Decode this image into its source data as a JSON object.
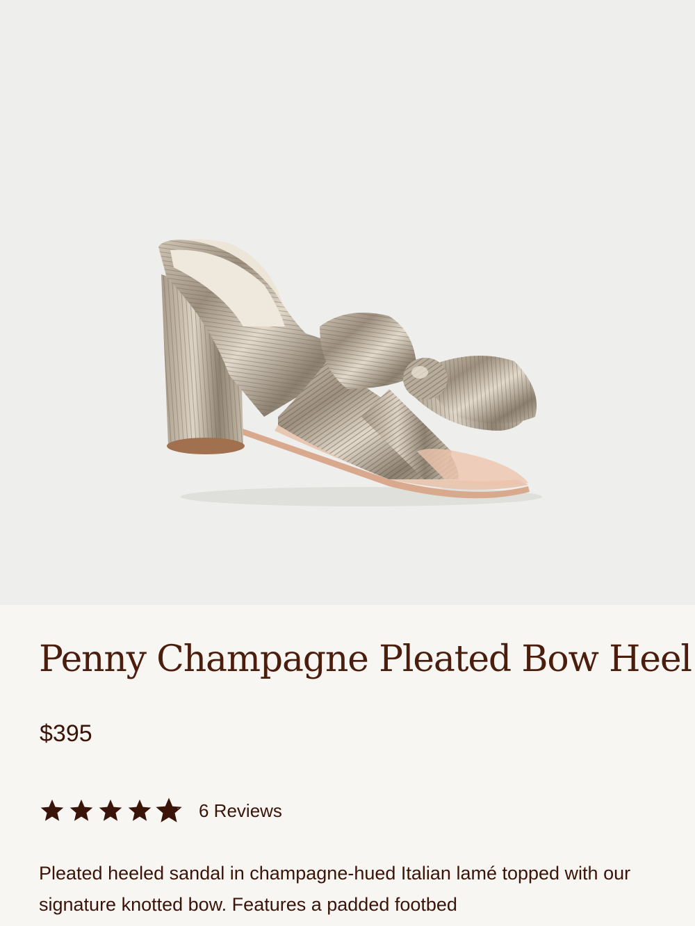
{
  "product": {
    "title": "Penny Champagne Pleated Bow Heel",
    "price": "$395",
    "rating": 4.8,
    "reviews_label": "6 Reviews",
    "description": "Pleated heeled sandal in champagne-hued Italian lamé topped with our signature knotted bow. Features a padded footbed",
    "image_alt": "Penny Champagne Pleated Bow Heel"
  },
  "colors": {
    "hero_background": "#eeeeec",
    "page_background": "#f8f6f3",
    "title_text": "#4a1d0d",
    "star_fill": "#3a1408"
  },
  "icons": {
    "star": "star-icon"
  }
}
